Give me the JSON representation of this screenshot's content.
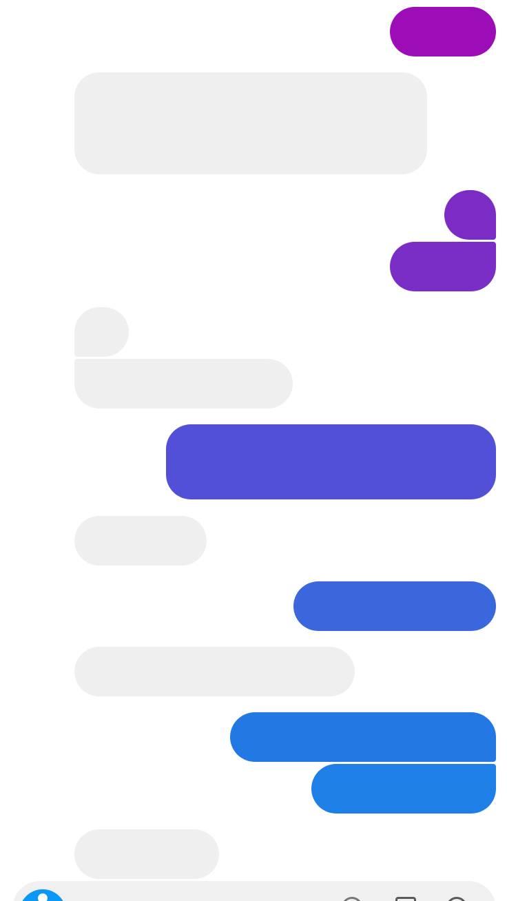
{
  "messages": [
    {
      "id": "m1",
      "direction": "outgoing",
      "text": ""
    },
    {
      "id": "m2",
      "direction": "incoming",
      "text": ""
    },
    {
      "id": "m3",
      "direction": "outgoing",
      "text": ""
    },
    {
      "id": "m4",
      "direction": "outgoing",
      "text": ""
    },
    {
      "id": "m5",
      "direction": "incoming",
      "text": ""
    },
    {
      "id": "m6",
      "direction": "incoming",
      "text": ""
    },
    {
      "id": "m7",
      "direction": "outgoing",
      "text": ""
    },
    {
      "id": "m8",
      "direction": "incoming",
      "text": ""
    },
    {
      "id": "m9",
      "direction": "outgoing",
      "text": ""
    },
    {
      "id": "m10",
      "direction": "incoming",
      "text": ""
    },
    {
      "id": "m11",
      "direction": "outgoing",
      "text": ""
    },
    {
      "id": "m12",
      "direction": "outgoing",
      "text": ""
    },
    {
      "id": "m13",
      "direction": "incoming",
      "text": ""
    }
  ],
  "colors": {
    "incoming_bubble": "#efefef",
    "outgoing_gradient": [
      "#9c0db8",
      "#7b2cc5",
      "#5350d8",
      "#3b67dc",
      "#2378e4",
      "#1e80e6"
    ],
    "composer_accent": "#0b97f5",
    "background": "#ffffff"
  },
  "composer": {
    "placeholder": "",
    "icons": [
      "camera-icon",
      "image-icon",
      "microphone-icon",
      "emoji-icon"
    ]
  }
}
